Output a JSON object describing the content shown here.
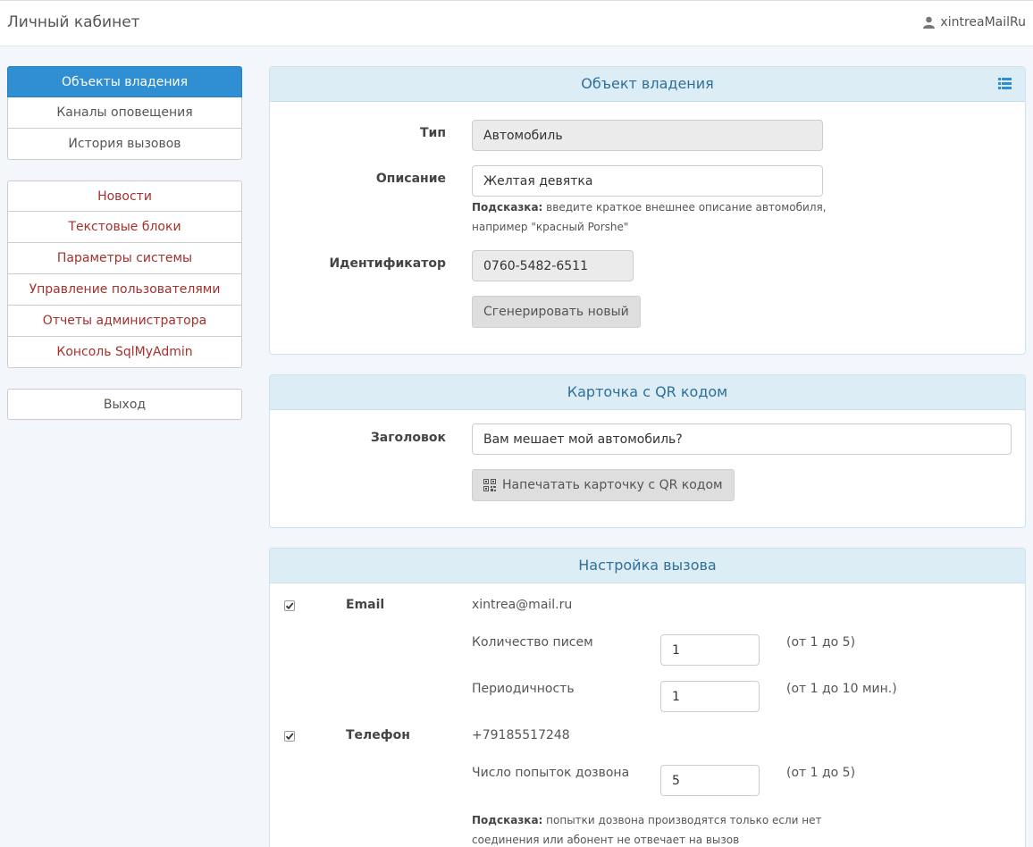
{
  "header": {
    "brand": "Личный кабинет",
    "user": "xintreaMailRu"
  },
  "sidebar": {
    "group1": [
      "Объекты владения",
      "Каналы оповещения",
      "История вызовов"
    ],
    "group2": [
      "Новости",
      "Текстовые блоки",
      "Параметры системы",
      "Управление пользователями",
      "Отчеты администратора",
      "Консоль SqlMyAdmin"
    ],
    "logout": "Выход"
  },
  "ownership": {
    "title": "Объект владения",
    "type_label": "Тип",
    "type_value": "Автомобиль",
    "desc_label": "Описание",
    "desc_value": "Желтая девятка",
    "desc_hint_bold": "Подсказка:",
    "desc_hint_line1": " введите краткое внешнее описание автомобиля,",
    "desc_hint_line2": "например \"красный Porshe\"",
    "id_label": "Идентификатор",
    "id_value": "0760-5482-6511",
    "generate_button": "Сгенерировать новый"
  },
  "qr_card": {
    "title": "Карточка с QR кодом",
    "header_label": "Заголовок",
    "header_value": "Вам мешает мой автомобиль?",
    "print_button": "Напечатать карточку с QR кодом"
  },
  "call_settings": {
    "title": "Настройка вызова",
    "email_label": "Email",
    "email_value": "xintrea@mail.ru",
    "letters_label": "Количество писем",
    "letters_value": "1",
    "letters_range": "(от 1 до 5)",
    "period_label": "Периодичность",
    "period_value": "1",
    "period_range": "(от 1 до 10 мин.)",
    "phone_label": "Телефон",
    "phone_value": "+79185517248",
    "attempts_label": "Число попыток дозвона",
    "attempts_value": "5",
    "attempts_range": "(от 1 до 5)",
    "phone_hint_bold": "Подсказка:",
    "phone_hint_line1": " попытки дозвона производятся только если нет",
    "phone_hint_line2": "соединения или абонент не отвечает на вызов"
  }
}
